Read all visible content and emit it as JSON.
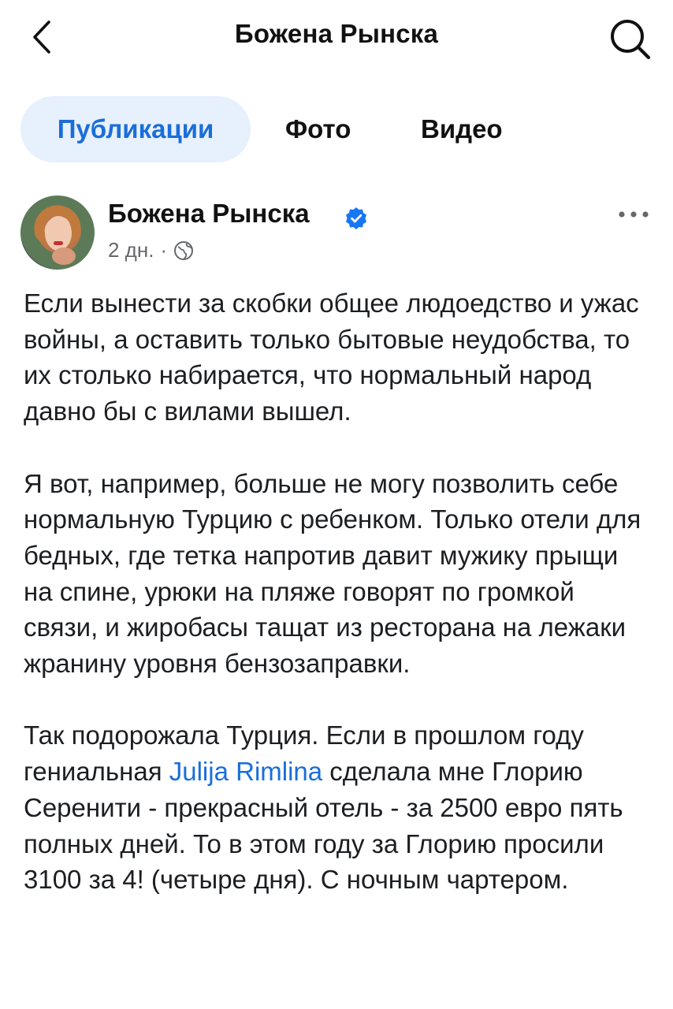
{
  "header": {
    "title": "Божена Рынска",
    "back_icon": "chevron-left-icon",
    "search_icon": "search-icon"
  },
  "tabs": [
    {
      "label": "Публикации",
      "active": true
    },
    {
      "label": "Фото",
      "active": false
    },
    {
      "label": "Видео",
      "active": false
    }
  ],
  "post": {
    "author": "Божена Рынска",
    "verified": true,
    "time": "2 дн.",
    "separator": "·",
    "audience_icon": "globe-icon",
    "more_icon": "more-horizontal-icon",
    "paragraph_1": "Если вынести за скобки общее людоедство и ужас войны, а оставить только бытовые неудобства, то их столько набирается, что нормальный народ давно бы с вилами вышел.",
    "paragraph_2": "Я вот, например, больше не могу позволить себе нормальную Турцию с ребенком. Только отели для бедных, где тетка напротив давит мужику прыщи на спине, урюки на пляже говорят по громкой связи, и жиробасы тащат из ресторана на лежаки жранину уровня бензозаправки.",
    "paragraph_3_before": "Так подорожала Турция. Если в прошлом году гениальная ",
    "paragraph_3_mention": "Julija Rimlina",
    "paragraph_3_after": " сделала мне Глорию Серенити - прекрасный отель - за 2500 евро пять полных дней. То в этом году за Глорию просили 3100 за 4! (четыре дня). С ночным чартером."
  },
  "colors": {
    "accent": "#1a6ed8",
    "active_tab_bg": "#e7f0fd",
    "verified_badge": "#1877f2",
    "meta_text": "#65676b"
  }
}
